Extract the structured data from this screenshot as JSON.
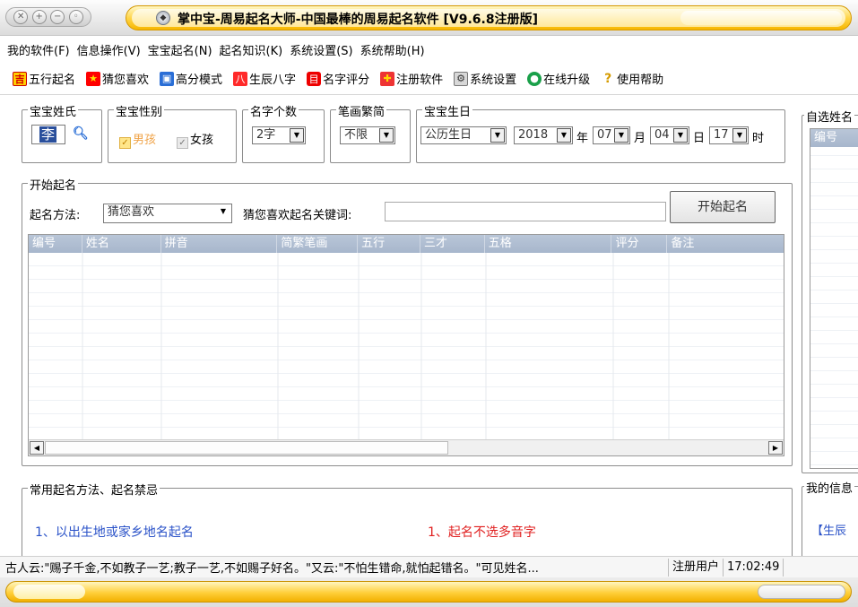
{
  "window": {
    "title": "掌中宝-周易起名大师-中国最棒的周易起名软件 [V9.6.8注册版]"
  },
  "menu": [
    "我的软件(F)",
    "信息操作(V)",
    "宝宝起名(N)",
    "起名知识(K)",
    "系统设置(S)",
    "系统帮助(H)"
  ],
  "toolbar": [
    {
      "label": "五行起名",
      "icon": "ji-icon",
      "glyph": "吉"
    },
    {
      "label": "猜您喜欢",
      "icon": "star-icon",
      "glyph": "★"
    },
    {
      "label": "高分模式",
      "icon": "monitor-icon",
      "glyph": "▣"
    },
    {
      "label": "生辰八字",
      "icon": "bazi-icon",
      "glyph": "八"
    },
    {
      "label": "名字评分",
      "icon": "book-icon",
      "glyph": "目"
    },
    {
      "label": "注册软件",
      "icon": "gift-icon",
      "glyph": "✚"
    },
    {
      "label": "系统设置",
      "icon": "settings-icon",
      "glyph": "⚙"
    },
    {
      "label": "在线升级",
      "icon": "globe-icon",
      "glyph": "●"
    },
    {
      "label": "使用帮助",
      "icon": "help-icon",
      "glyph": "?"
    }
  ],
  "surname": {
    "legend": "宝宝姓氏",
    "value": "李"
  },
  "gender": {
    "legend": "宝宝性别",
    "male": "男孩",
    "female": "女孩"
  },
  "name_length": {
    "legend": "名字个数",
    "value": "2字"
  },
  "strokes": {
    "legend": "笔画繁简",
    "value": "不限"
  },
  "birth": {
    "legend": "宝宝生日",
    "calendar": "公历生日",
    "year": "2018",
    "year_unit": "年",
    "month": "07",
    "month_unit": "月",
    "day": "04",
    "day_unit": "日",
    "hour": "17",
    "hour_unit": "时"
  },
  "start": {
    "legend": "开始起名",
    "method_label": "起名方法:",
    "method_value": "猜您喜欢",
    "keyword_label": "猜您喜欢起名关键词:",
    "keyword_value": "",
    "button": "开始起名"
  },
  "grid": {
    "columns": [
      "编号",
      "姓名",
      "拼音",
      "简繁笔画",
      "五行",
      "三才",
      "五格",
      "评分",
      "备注"
    ]
  },
  "tips": {
    "legend": "常用起名方法、起名禁忌",
    "left": "1、以出生地或家乡地名起名",
    "right": "1、起名不选多音字",
    "left_color": "#2a52c8",
    "right_color": "#e02020"
  },
  "right_panel": {
    "legend_top": "自选姓名",
    "col": "编号",
    "legend_bottom": "我的信息",
    "snippet": "【生辰"
  },
  "status": {
    "quote": "古人云:\"赐子千金,不如教子一艺;教子一艺,不如赐子好名。\"又云:\"不怕生错命,就怕起错名。\"可见姓名...",
    "user": "注册用户",
    "time": "17:02:49"
  }
}
